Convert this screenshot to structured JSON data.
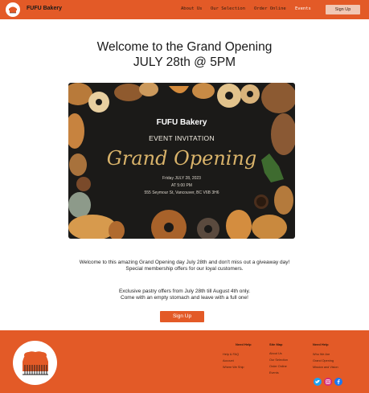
{
  "header": {
    "brand": "FUFU Bakery",
    "nav": [
      "About Us",
      "Our Selection",
      "Order Online",
      "Events"
    ],
    "signup_label": "Sign Up"
  },
  "hero": {
    "title_line1": "Welcome to the Grand Opening",
    "title_line2": "JULY 28th @ 5PM"
  },
  "invitation": {
    "brand": "FUFU Bakery",
    "event": "EVENT INVITATION",
    "script": "Grand Opening",
    "date": "Friday JULY 28, 2023",
    "time": "AT 5:00 PM",
    "address": "555 Seymour St, Vancouver, BC V6B 3H6"
  },
  "body": {
    "p1_line1": "Welcome to this amazing Grand Opening day July 28th and don't miss out a giveaway day!",
    "p1_line2": "Special membership offers for our loyal customers.",
    "p2_line1": "Exclusive pastry offers from July 28th till August 4th only.",
    "p2_line2": "Come with an empty stomach and leave with a full one!",
    "signup_label": "Sign Up"
  },
  "footer": {
    "col1": {
      "heading": "Need Help",
      "links": [
        "Help & FAQ",
        "Account",
        "Where We Ship"
      ]
    },
    "col2": {
      "heading": "Site Map",
      "links": [
        "About Us",
        "Our Selection",
        "Order Online",
        "Events"
      ]
    },
    "col3": {
      "heading": "Need Help",
      "links": [
        "Who We Are",
        "Grand Opening",
        "Mission and Vision"
      ]
    },
    "social": [
      "twitter",
      "instagram",
      "facebook"
    ]
  },
  "colors": {
    "brand_orange": "#e35a27",
    "header_button": "#f1c7b4"
  }
}
